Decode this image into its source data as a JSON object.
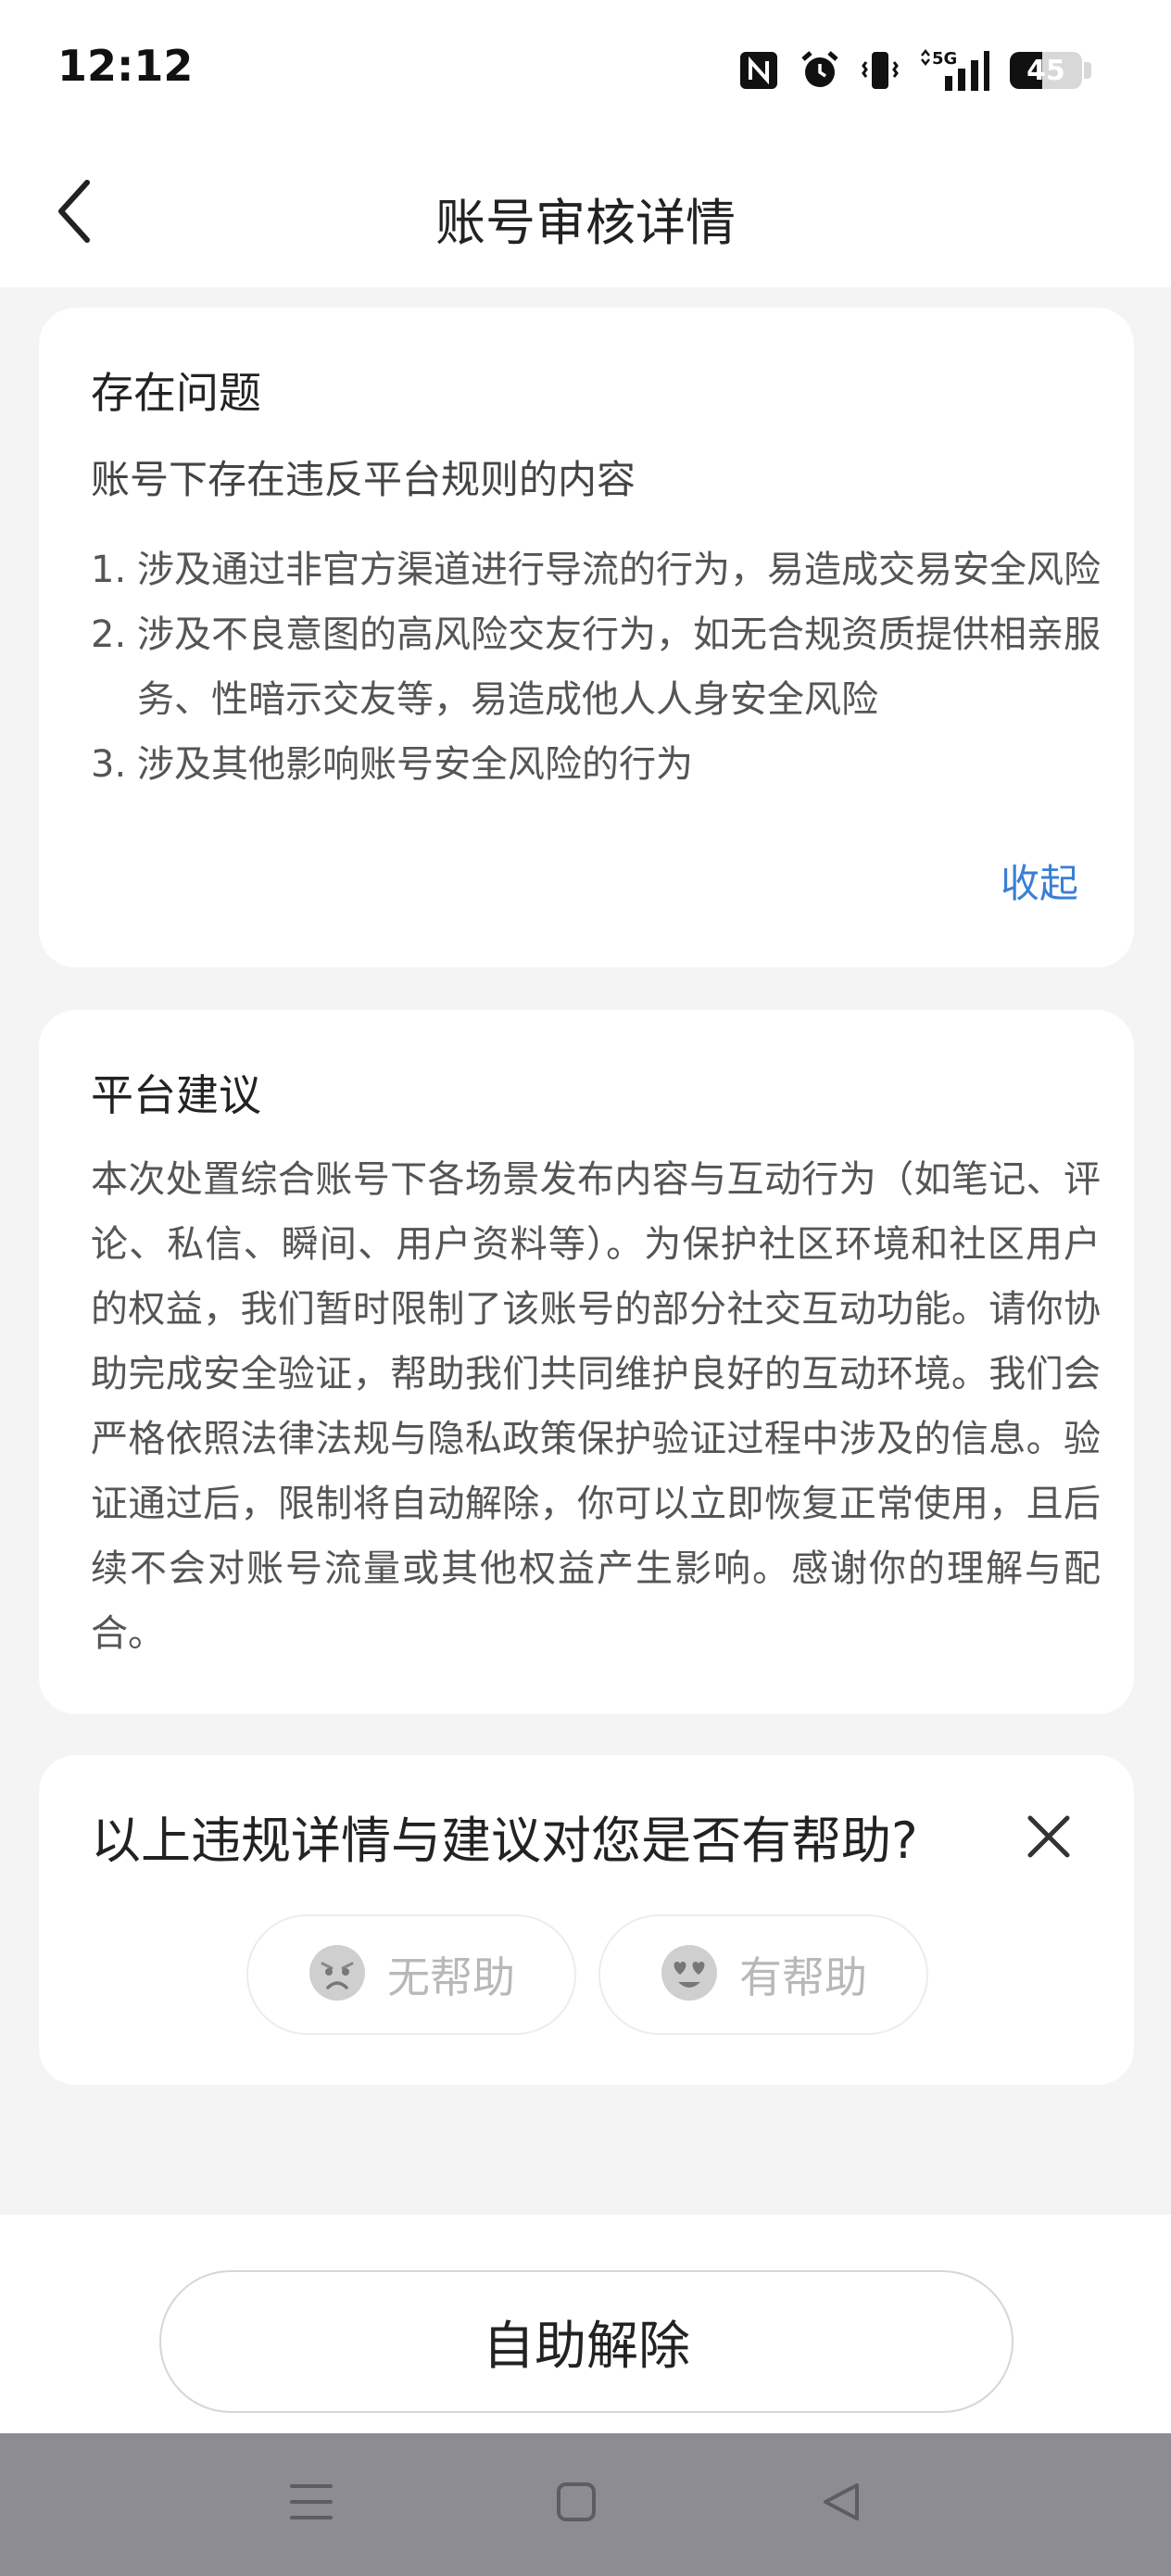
{
  "status_bar": {
    "time": "12:12",
    "battery": "45",
    "battery_level_percent": 45,
    "icons": [
      "nfc-icon",
      "alarm-icon",
      "vibrate-icon",
      "signal-5g-icon",
      "battery-icon"
    ],
    "network_label": "5G"
  },
  "header": {
    "title": "账号审核详情",
    "back_icon": "chevron-left-icon"
  },
  "issues_card": {
    "title": "存在问题",
    "subtitle": "账号下存在违反平台规则的内容",
    "items": [
      {
        "num": "1.",
        "text": "涉及通过非官方渠道进行导流的行为，易造成交易安全风险"
      },
      {
        "num": "2.",
        "text": "涉及不良意图的高风险交友行为，如无合规资质提供相亲服务、性暗示交友等，易造成他人人身安全风险"
      },
      {
        "num": "3.",
        "text": "涉及其他影响账号安全风险的行为"
      }
    ],
    "collapse_label": "收起"
  },
  "advice_card": {
    "title": "平台建议",
    "body": "本次处置综合账号下各场景发布内容与互动行为（如笔记、评论、私信、瞬间、用户资料等）。为保护社区环境和社区用户的权益，我们暂时限制了该账号的部分社交互动功能。请你协助完成安全验证，帮助我们共同维护良好的互动环境。我们会严格依照法律法规与隐私政策保护验证过程中涉及的信息。验证通过后，限制将自动解除，你可以立即恢复正常使用，且后续不会对账号流量或其他权益产生影响。感谢你的理解与配合。"
  },
  "feedback_card": {
    "question": "以上违规详情与建议对您是否有帮助?",
    "not_helpful_label": "无帮助",
    "helpful_label": "有帮助",
    "not_helpful_icon": "sad-face-icon",
    "helpful_icon": "heart-eyes-face-icon",
    "close_icon": "close-icon"
  },
  "bottom": {
    "primary_button_label": "自助解除"
  },
  "nav_bar": {
    "icons": [
      "menu-icon",
      "home-square-icon",
      "back-triangle-icon"
    ]
  },
  "colors": {
    "page_background": "#f4f4f4",
    "card_background": "#ffffff",
    "link_blue": "#3a7fd6",
    "nav_bar_gray": "#8c8c92"
  }
}
